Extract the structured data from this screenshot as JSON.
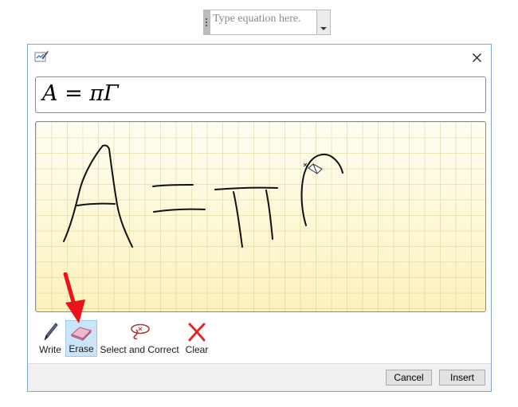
{
  "document": {
    "equation_placeholder": "Type equation here."
  },
  "dialog": {
    "preview_equation": "A = πΓ",
    "toolbar": {
      "write_label": "Write",
      "erase_label": "Erase",
      "select_correct_label": "Select and Correct",
      "clear_label": "Clear",
      "active_tool": "Erase"
    },
    "footer": {
      "cancel_label": "Cancel",
      "insert_label": "Insert"
    }
  },
  "icons": {
    "app": "math-input-icon",
    "close": "close-icon",
    "write": "pen-icon",
    "erase": "eraser-icon",
    "select": "lasso-icon",
    "clear": "clear-x-icon"
  },
  "colors": {
    "pad_background": "#fdf5c4",
    "active_tool": "#cce4f7",
    "annotation_arrow": "#e8141a",
    "dialog_border": "#7aa6d8"
  }
}
